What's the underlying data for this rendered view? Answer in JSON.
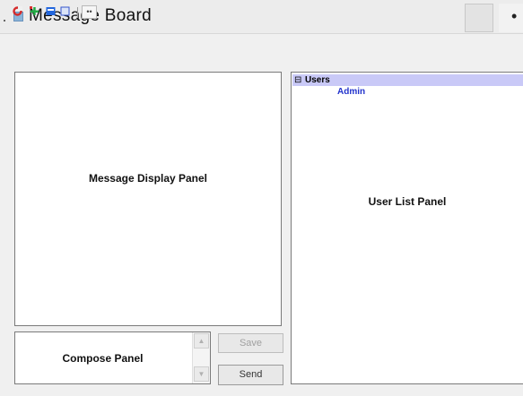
{
  "window": {
    "title": "Message Board",
    "close_glyph": "•"
  },
  "toolbar": {
    "icons": [
      "refresh-icon",
      "add-user-icon",
      "inbox-icon",
      "settings-icon",
      "info-icon"
    ],
    "info_glyph": "••",
    "colors": {
      "refresh": "#d42a2a",
      "add_user": "#22aa44",
      "inbox": "#2266dd",
      "settings": "#3355cc"
    }
  },
  "panels": {
    "message_display_label": "Message Display Panel",
    "user_list_label": "User List Panel",
    "compose_label": "Compose Panel"
  },
  "buttons": {
    "save_label": "Save",
    "send_label": "Send"
  },
  "compose_scroll": {
    "up_glyph": "▲",
    "down_glyph": "▼"
  },
  "user_tree": {
    "expander_glyph": "⊟",
    "root_label": "Users",
    "children": [
      {
        "label": "Admin"
      }
    ]
  }
}
